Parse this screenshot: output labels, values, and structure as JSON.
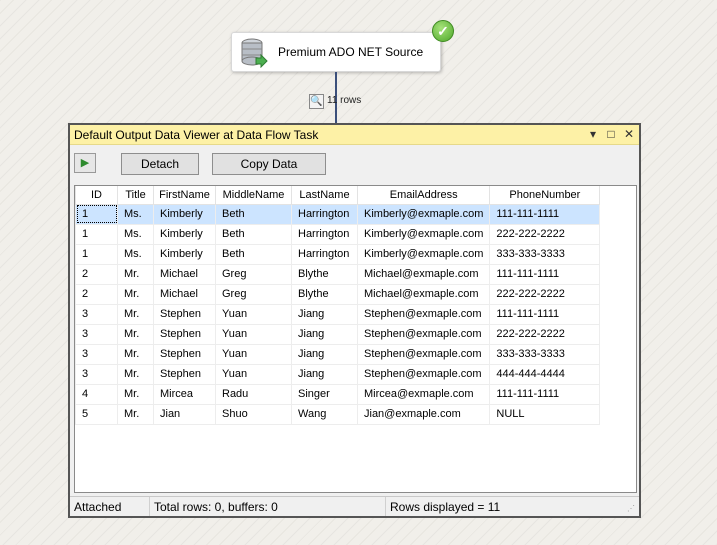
{
  "canvas": {
    "source_component": {
      "label": "Premium ADO NET Source",
      "icon": "database-icon",
      "status_icon": "success-check-icon"
    },
    "path": {
      "row_count_label": "11 rows",
      "viewer_icon": "data-viewer-magnifier-icon"
    }
  },
  "viewer": {
    "title": "Default Output Data Viewer at Data Flow Task",
    "title_buttons": {
      "dropdown": "▾",
      "maximize": "□",
      "close": "✕"
    },
    "toolbar": {
      "play_icon": "▶",
      "detach_label": "Detach",
      "copy_label": "Copy Data"
    },
    "table": {
      "columns": [
        "ID",
        "Title",
        "FirstName",
        "MiddleName",
        "LastName",
        "EmailAddress",
        "PhoneNumber"
      ],
      "rows": [
        [
          "1",
          "Ms.",
          "Kimberly",
          "Beth",
          "Harrington",
          "Kimberly@exmaple.com",
          "111-111-1111"
        ],
        [
          "1",
          "Ms.",
          "Kimberly",
          "Beth",
          "Harrington",
          "Kimberly@exmaple.com",
          "222-222-2222"
        ],
        [
          "1",
          "Ms.",
          "Kimberly",
          "Beth",
          "Harrington",
          "Kimberly@exmaple.com",
          "333-333-3333"
        ],
        [
          "2",
          "Mr.",
          "Michael",
          "Greg",
          "Blythe",
          "Michael@exmaple.com",
          "111-111-1111"
        ],
        [
          "2",
          "Mr.",
          "Michael",
          "Greg",
          "Blythe",
          "Michael@exmaple.com",
          "222-222-2222"
        ],
        [
          "3",
          "Mr.",
          "Stephen",
          "Yuan",
          "Jiang",
          "Stephen@exmaple.com",
          "111-111-1111"
        ],
        [
          "3",
          "Mr.",
          "Stephen",
          "Yuan",
          "Jiang",
          "Stephen@exmaple.com",
          "222-222-2222"
        ],
        [
          "3",
          "Mr.",
          "Stephen",
          "Yuan",
          "Jiang",
          "Stephen@exmaple.com",
          "333-333-3333"
        ],
        [
          "3",
          "Mr.",
          "Stephen",
          "Yuan",
          "Jiang",
          "Stephen@exmaple.com",
          "444-444-4444"
        ],
        [
          "4",
          "Mr.",
          "Mircea",
          "Radu",
          "Singer",
          "Mircea@exmaple.com",
          "111-111-1111"
        ],
        [
          "5",
          "Mr.",
          "Jian",
          "Shuo",
          "Wang",
          "Jian@exmaple.com",
          "NULL"
        ]
      ],
      "selected_row": 0
    },
    "status": {
      "state": "Attached",
      "totals": "Total rows: 0, buffers: 0",
      "displayed": "Rows displayed = 11"
    }
  }
}
